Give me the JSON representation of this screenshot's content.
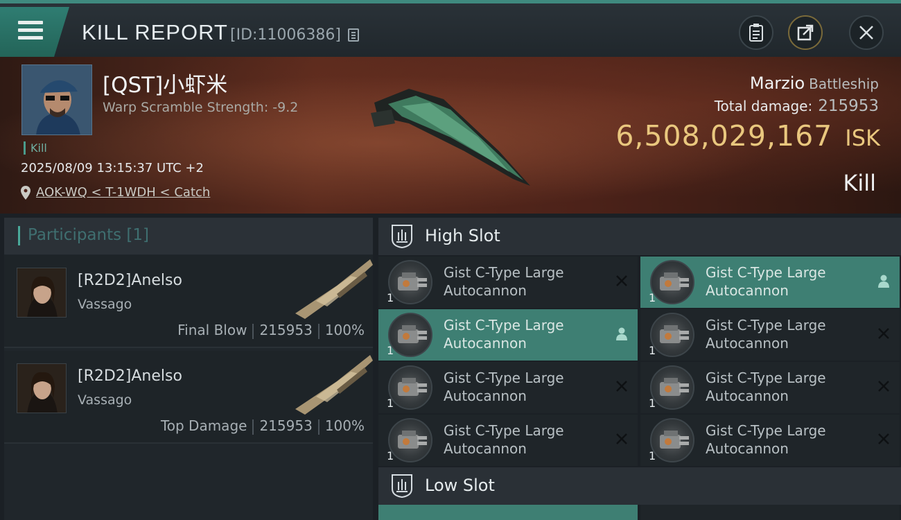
{
  "header": {
    "title": "KILL REPORT",
    "kill_id": "[ID:11006386]"
  },
  "victim": {
    "name": "[QST]小虾米",
    "warp_scramble": "Warp Scramble Strength: -9.2",
    "tag": "Kill",
    "timestamp": "2025/08/09 13:15:37 UTC +2",
    "location": "AOK-WQ < T-1WDH < Catch",
    "ship_name": "Marzio",
    "ship_class": "Battleship",
    "total_damage_label": "Total damage:",
    "total_damage": "215953",
    "isk_value": "6,508,029,167",
    "isk_unit": "ISK",
    "result": "Kill"
  },
  "participants": {
    "title": "Participants [1]",
    "items": [
      {
        "name": "[R2D2]Anelso",
        "ship": "Vassago",
        "role": "Final Blow",
        "damage": "215953",
        "percent": "100%"
      },
      {
        "name": "[R2D2]Anelso",
        "ship": "Vassago",
        "role": "Top Damage",
        "damage": "215953",
        "percent": "100%"
      }
    ]
  },
  "high_slot": {
    "title": "High Slot",
    "modules": [
      {
        "name_line1": "Gist C-Type Large",
        "name_line2": "Autocannon",
        "qty": "1",
        "marker": "close-icon",
        "active": false
      },
      {
        "name_line1": "Gist C-Type Large",
        "name_line2": "Autocannon",
        "qty": "1",
        "marker": "person-icon",
        "active": true
      },
      {
        "name_line1": "Gist C-Type Large",
        "name_line2": "Autocannon",
        "qty": "1",
        "marker": "person-icon",
        "active": true
      },
      {
        "name_line1": "Gist C-Type Large",
        "name_line2": "Autocannon",
        "qty": "1",
        "marker": "close-icon",
        "active": false
      },
      {
        "name_line1": "Gist C-Type Large",
        "name_line2": "Autocannon",
        "qty": "1",
        "marker": "close-icon",
        "active": false
      },
      {
        "name_line1": "Gist C-Type Large",
        "name_line2": "Autocannon",
        "qty": "1",
        "marker": "close-icon",
        "active": false
      },
      {
        "name_line1": "Gist C-Type Large",
        "name_line2": "Autocannon",
        "qty": "1",
        "marker": "close-icon",
        "active": false
      },
      {
        "name_line1": "Gist C-Type Large",
        "name_line2": "Autocannon",
        "qty": "1",
        "marker": "close-icon",
        "active": false
      }
    ]
  },
  "low_slot": {
    "title": "Low Slot"
  },
  "colors": {
    "accent": "#3e7f73",
    "isk": "#e9c77e"
  }
}
